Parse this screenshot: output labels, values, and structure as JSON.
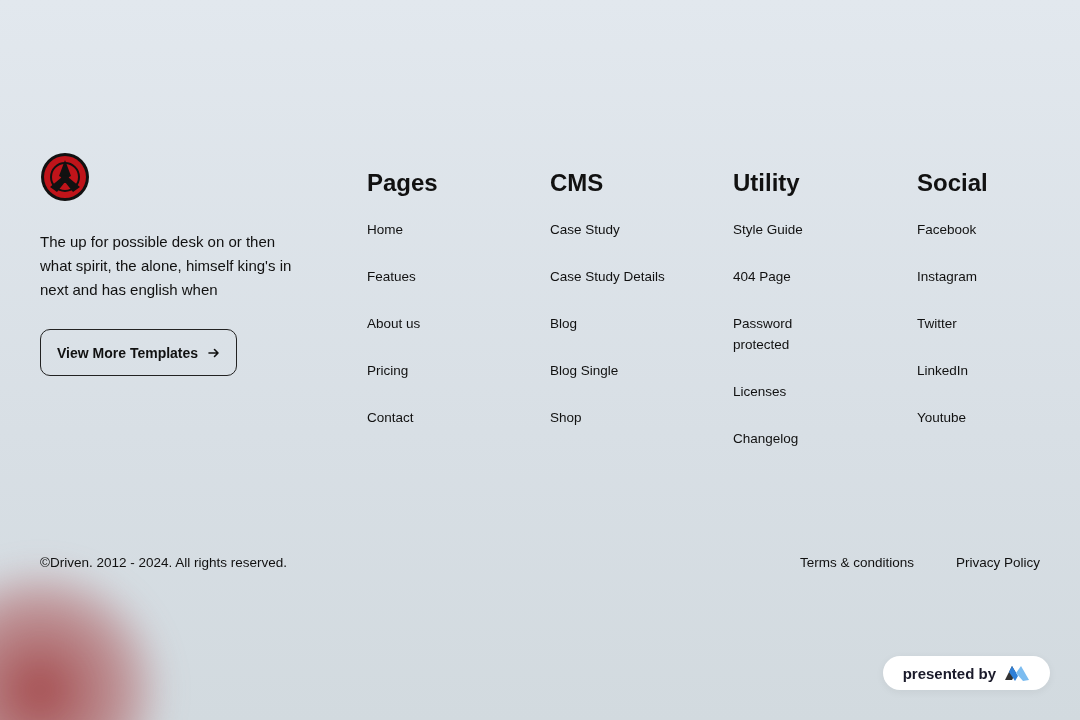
{
  "brand": {
    "description": "The up for possible desk on or then what spirit, the alone, himself king's in next and has english when",
    "button": "View More Templates"
  },
  "columns": [
    {
      "heading": "Pages",
      "links": [
        "Home",
        "Featues",
        "About us",
        "Pricing",
        "Contact"
      ]
    },
    {
      "heading": "CMS",
      "links": [
        "Case Study",
        "Case Study Details",
        "Blog",
        "Blog Single",
        "Shop"
      ]
    },
    {
      "heading": "Utility",
      "links": [
        "Style Guide",
        "404 Page",
        "Password protected",
        "Licenses",
        "Changelog"
      ]
    },
    {
      "heading": "Social",
      "links": [
        "Facebook",
        "Instagram",
        "Twitter",
        "LinkedIn",
        "Youtube"
      ]
    }
  ],
  "bottom": {
    "copyright": "©Driven. 2012 - 2024. All rights reserved.",
    "links": [
      "Terms & conditions",
      "Privacy Policy"
    ]
  },
  "badge": {
    "label": "presented by"
  }
}
